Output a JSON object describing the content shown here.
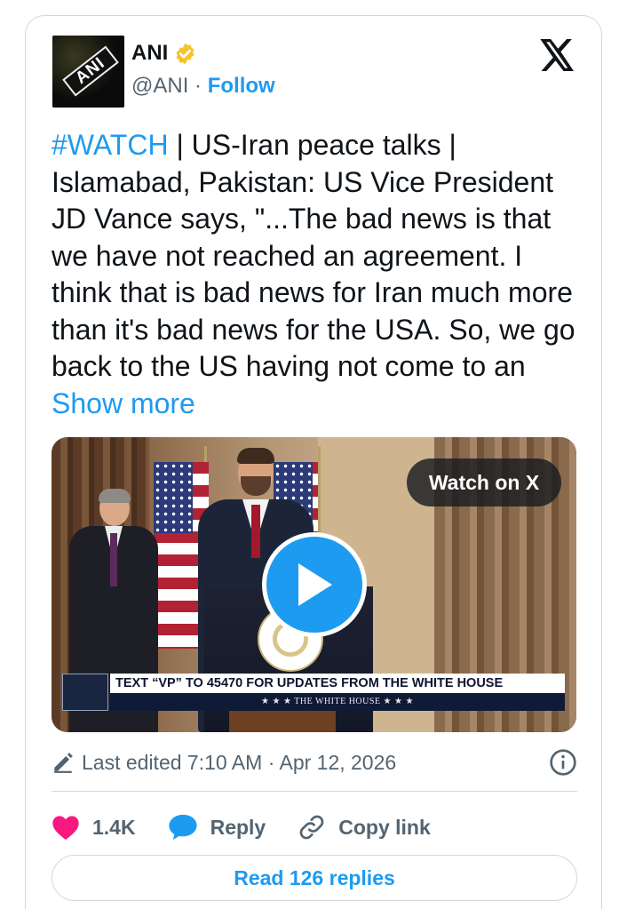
{
  "author": {
    "name": "ANI",
    "handle": "@ANI",
    "separator": "·",
    "follow_label": "Follow",
    "avatar_text": "ANI",
    "verified_color": "#f4c430"
  },
  "post": {
    "hashtag": "#WATCH",
    "text": " | US-Iran peace talks | Islamabad, Pakistan: US Vice President JD Vance says, \"...The bad news is that we have not reached an agreement. I think that is bad news for Iran much more than it's bad news for the USA. So, we go back to the US having not come to an ",
    "show_more": "Show more"
  },
  "video": {
    "watch_label": "Watch on X",
    "lower_third_main": "TEXT “VP” TO 45470 FOR UPDATES FROM THE WHITE HOUSE",
    "lower_third_sub": "★ ★ ★   THE WHITE HOUSE   ★ ★ ★"
  },
  "meta": {
    "edited_label": "Last edited 7:10 AM · Apr 12, 2026"
  },
  "actions": {
    "like_count": "1.4K",
    "reply_label": "Reply",
    "copy_label": "Copy link"
  },
  "replies": {
    "read_label": "Read 126 replies"
  },
  "colors": {
    "accent": "#1d9bf0",
    "like": "#f91880",
    "secondary_text": "#536471"
  },
  "icons": [
    "verified-badge-icon",
    "x-logo-icon",
    "play-icon",
    "pencil-icon",
    "info-icon",
    "heart-icon",
    "reply-bubble-icon",
    "link-icon"
  ]
}
